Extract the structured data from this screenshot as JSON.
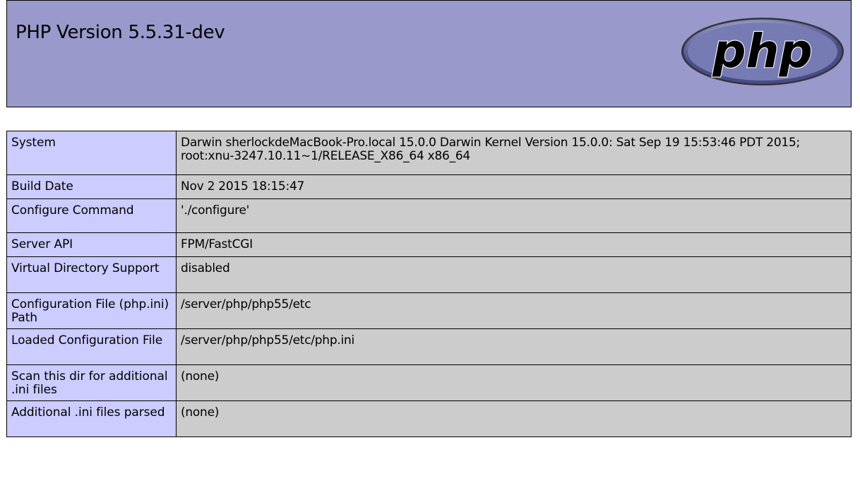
{
  "header": {
    "title": "PHP Version 5.5.31-dev",
    "logo_text": "php",
    "logo_colors": {
      "oval": "#6c7eb7",
      "oval_dark": "#4f5b93",
      "text": "#000000"
    }
  },
  "rows": [
    {
      "label": "System",
      "value": "Darwin sherlockdeMacBook-Pro.local 15.0.0 Darwin Kernel Version 15.0.0: Sat Sep 19 15:53:46 PDT 2015; root:xnu-3247.10.11~1/RELEASE_X86_64 x86_64"
    },
    {
      "label": "Build Date",
      "value": "Nov 2 2015 18:15:47"
    },
    {
      "label": "Configure Command",
      "value": "'./configure'"
    },
    {
      "label": "Server API",
      "value": "FPM/FastCGI"
    },
    {
      "label": "Virtual Directory Support",
      "value": "disabled"
    },
    {
      "label": "Configuration File (php.ini) Path",
      "value": "/server/php/php55/etc"
    },
    {
      "label": "Loaded Configuration File",
      "value": "/server/php/php55/etc/php.ini"
    },
    {
      "label": "Scan this dir for additional .ini files",
      "value": "(none)"
    },
    {
      "label": "Additional .ini files parsed",
      "value": "(none)"
    }
  ],
  "colors": {
    "header_bg": "#9999cc",
    "label_bg": "#ccccff",
    "value_bg": "#cccccc"
  }
}
